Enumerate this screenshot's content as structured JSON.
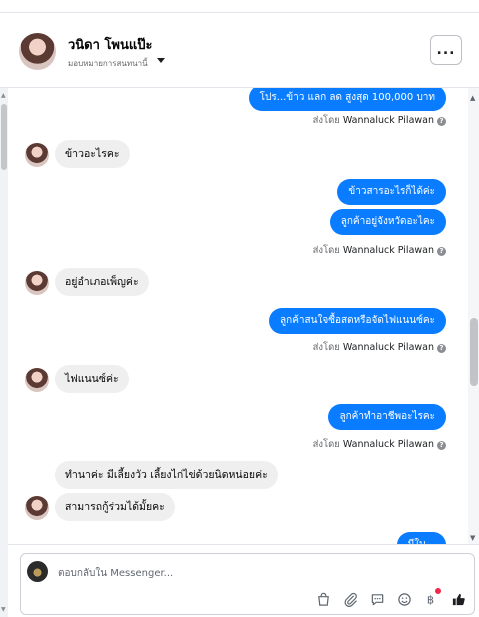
{
  "header": {
    "contact_name": "วนิดา โพนแป๊ะ",
    "assign_label": "มอบหมายการสนทนานี้",
    "more_label": "..."
  },
  "thread": {
    "messages": [
      {
        "type": "out",
        "text": "โปร...ข้าว แลก ลด สูงสุด 100,000 บาท"
      },
      {
        "type": "sent_by",
        "prefix": "ส่งโดย",
        "name": "Wannaluck Pilawan"
      },
      {
        "type": "in",
        "text": "ข้าวอะไรคะ"
      },
      {
        "type": "out",
        "text": "ข้าวสารอะไรก็ได้ค่ะ"
      },
      {
        "type": "out",
        "text": "ลูกค้าอยู่จังหวัดอะไคะ"
      },
      {
        "type": "sent_by",
        "prefix": "ส่งโดย",
        "name": "Wannaluck Pilawan"
      },
      {
        "type": "in",
        "text": "อยู่อำเภอเพ็ญค่ะ"
      },
      {
        "type": "out",
        "text": "ลูกค้าสนใจซื้อสดหรือจัดไฟแนนซ์คะ"
      },
      {
        "type": "sent_by",
        "prefix": "ส่งโดย",
        "name": "Wannaluck Pilawan"
      },
      {
        "type": "in",
        "text": "ไฟแนนซ์ค่ะ"
      },
      {
        "type": "out",
        "text": "ลูกค้าทำอาชีพอะไรคะ"
      },
      {
        "type": "sent_by",
        "prefix": "ส่งโดย",
        "name": "Wannaluck Pilawan"
      },
      {
        "type": "in",
        "text": "ทำนาค่ะ มีเลี้ยงวัว เลี้ยงไก่ไข่ด้วยนิดหน่อยค่ะ"
      },
      {
        "type": "in",
        "text": "สามารถกู้ร่วมได้มั้ยคะ"
      },
      {
        "type": "out",
        "text": "มีใบ..."
      }
    ]
  },
  "composer": {
    "placeholder": "ตอบกลับใน Messenger..."
  },
  "toolbar_icons": [
    "bag-icon",
    "paperclip-icon",
    "chat-icon",
    "emoji-icon",
    "baht-icon",
    "like-icon"
  ]
}
